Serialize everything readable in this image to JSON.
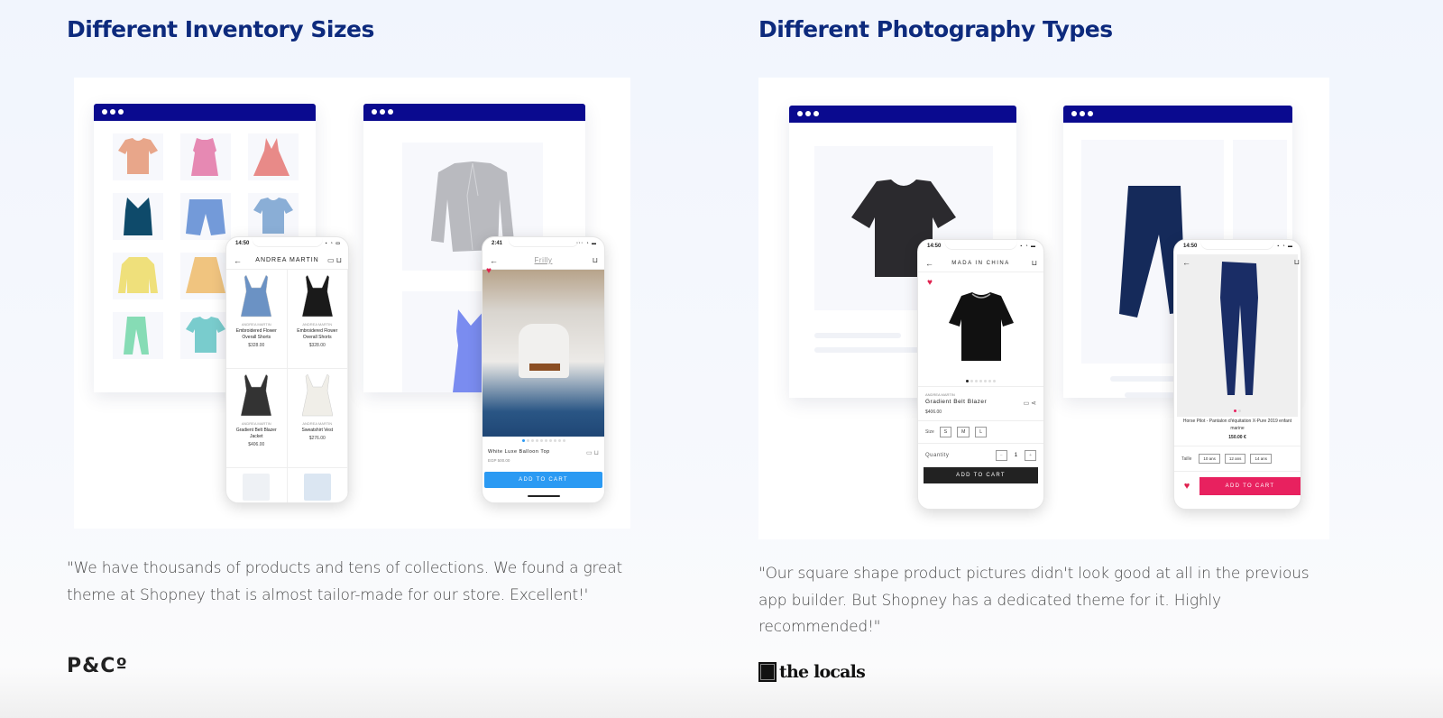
{
  "sections": [
    {
      "title": "Different Inventory Sizes",
      "quote": "\"We have thousands of products and tens of collections. We found a great theme at Shopney that is almost tailor-made for our store. Excellent!'",
      "logo_text": "P&Cº",
      "browser_grid_colors": [
        "#e8a68a",
        "#e689b3",
        "#e88a88",
        "#0e4a6a",
        "#739ad9",
        "#8aaed6",
        "#efe07b",
        "#f0c47f",
        null,
        "#86dcb5",
        "#79cccd",
        null
      ],
      "browser_single": {
        "jacket_color": "#b9babf",
        "dress_color": "#7a8cf0"
      },
      "phone_grid": {
        "time": "14:50",
        "title": "ANDREA MARTIN",
        "products": [
          {
            "brand": "ANDREA MARTIN",
            "name": "Embroidered Flower Overall Shorts",
            "price": "$328.00"
          },
          {
            "brand": "ANDREA MARTIN",
            "name": "Embroidered Flower Overall Shorts",
            "price": "$328.00"
          },
          {
            "brand": "ANDREA MARTIN",
            "name": "Gradient Belt Blazer Jacket",
            "price": "$406.00"
          },
          {
            "brand": "ANDREA MARTIN",
            "name": "Sweatshirt Vest",
            "price": "$276.00"
          }
        ]
      },
      "phone_detail": {
        "time": "2:41",
        "title": "Frilly",
        "product_name": "White Luxe Balloon Top",
        "price": "EGP 500.00",
        "add_to_cart": "ADD TO CART",
        "accent": "#2b9af3"
      }
    },
    {
      "title": "Different Photography Types",
      "quote": "\"Our square shape product pictures didn't look good at all in the previous app builder. But Shopney has a dedicated theme for it. Highly recommended!\"",
      "logo_text": "the locals",
      "phone_detail_a": {
        "time": "14:50",
        "title": "MADA IN CHINA",
        "brand": "ANDREA MARTIN",
        "product_name": "Gradient Belt Blazer",
        "price": "$406.00",
        "size_label": "Size",
        "sizes": [
          "S",
          "M",
          "L"
        ],
        "quantity_label": "Quantity",
        "quantity": "1",
        "add_to_cart": "ADD TO CART",
        "accent": "#222222"
      },
      "phone_detail_b": {
        "time": "14:50",
        "product_name": "Horse Pilot - Pantalon d'équitation X-Pure 2019 enfant marine",
        "price": "150.00 €",
        "size_label": "Taille",
        "sizes": [
          "10 ans",
          "12 ans",
          "14 ans"
        ],
        "add_to_cart": "ADD TO CART",
        "accent": "#e8215f"
      }
    }
  ]
}
